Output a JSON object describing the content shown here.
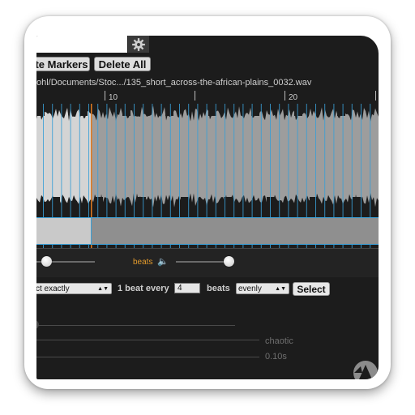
{
  "toolbar": {
    "delete_markers_label": "te Markers",
    "delete_all_label": "Delete All"
  },
  "file_path": "ohl/Documents/Stoc.../135_short_across-the-african-plains_0032.wav",
  "ruler": {
    "labels": [
      "10",
      "20"
    ]
  },
  "controls": {
    "beats_label": "beats",
    "speaker_icon": "speaker-icon"
  },
  "select_row": {
    "mode_value": "ct exactly",
    "one_beat_every_label": "1 beat every",
    "beat_count_value": "4",
    "beats_label": "beats",
    "distribution_value": "evenly",
    "select_button_label": "Select"
  },
  "lower": {
    "chaotic_label": "chaotic",
    "time_value": "0.10s"
  },
  "colors": {
    "marker_blue": "#3a9fd6",
    "playhead_orange": "#e07a1f",
    "accent_orange": "#e29a2c"
  }
}
